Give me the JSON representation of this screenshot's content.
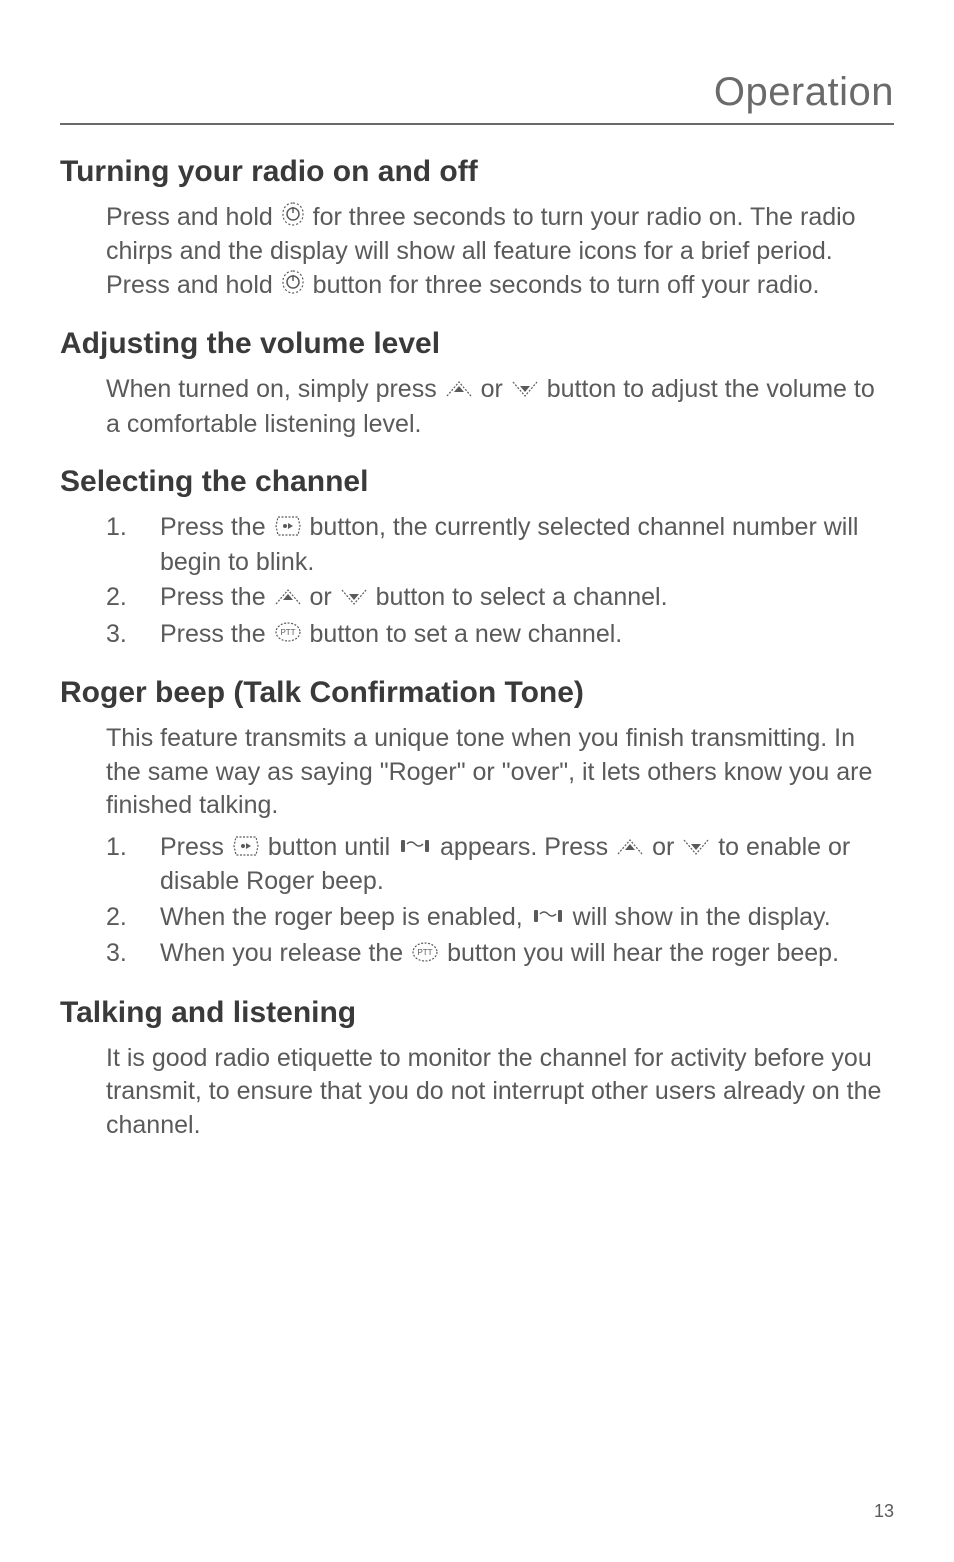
{
  "header": {
    "title": "Operation"
  },
  "sections": {
    "turning": {
      "heading": "Turning your radio on and off",
      "p1a": "Press and hold ",
      "p1b": " for three seconds to turn your radio on. The radio chirps and the display will show all feature icons for a brief period. Press and hold ",
      "p1c": " button for three seconds to turn off your radio."
    },
    "volume": {
      "heading": "Adjusting the volume level",
      "p1a": "When turned on, simply press ",
      "p1b": " or ",
      "p1c": " button to adjust the volume to a comfortable listening level."
    },
    "channel": {
      "heading": "Selecting the channel",
      "li1a": "Press the ",
      "li1b": " button, the currently selected channel number will begin to blink.",
      "li2a": "Press the ",
      "li2b": " or ",
      "li2c": " button to select a channel.",
      "li3a": "Press the ",
      "li3b": " button to set a new channel."
    },
    "roger": {
      "heading": "Roger beep (Talk Confirmation Tone)",
      "p1": "This feature transmits a unique tone when you finish transmitting. In the same way as saying \"Roger\" or \"over\", it lets others know you are finished talking.",
      "li1a": "Press ",
      "li1b": " button until ",
      "li1c": " appears. Press ",
      "li1d": " or ",
      "li1e": " to enable or disable Roger beep.",
      "li2a": "When the roger beep is enabled, ",
      "li2b": " will show in the display.",
      "li3a": "When you release the ",
      "li3b": " button you will hear the roger beep."
    },
    "talking": {
      "heading": "Talking and listening",
      "p1": "It is good radio etiquette to monitor the channel for activity before you transmit, to ensure that you do not interrupt other users already on the channel."
    }
  },
  "page_number": "13"
}
